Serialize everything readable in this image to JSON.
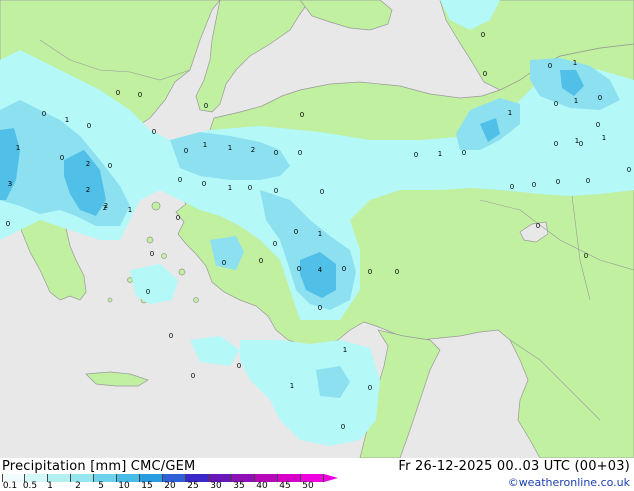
{
  "map": {
    "colors": {
      "sea": "#e8e8e8",
      "land": "#c0f0a0",
      "border": "#999999",
      "precip_light": "#b4f8f8",
      "precip_medium": "#8ce0f0",
      "precip_heavy": "#50c0e8"
    },
    "point_values": [
      "0",
      "1",
      "0",
      "0",
      "1",
      "0",
      "0",
      "2",
      "0",
      "0",
      "1",
      "2",
      "2",
      "0",
      "3",
      "0",
      "0",
      "0",
      "1",
      "0",
      "1",
      "1",
      "2",
      "0",
      "0",
      "0",
      "0",
      "0",
      "0",
      "0",
      "1",
      "1",
      "0",
      "0",
      "0",
      "0",
      "0",
      "4",
      "0",
      "0",
      "0",
      "0",
      "0",
      "0",
      "0",
      "1",
      "2",
      "0",
      "0",
      "0",
      "0",
      "1",
      "0",
      "0",
      "0",
      "0",
      "1",
      "0",
      "0",
      "1",
      "0",
      "0",
      "0",
      "0",
      "1",
      "0",
      "0",
      "1",
      "0",
      "0",
      "0",
      "0",
      "0",
      "1"
    ]
  },
  "footer": {
    "title": "Precipitation [mm]  CMC/GEM",
    "datetime": "Fr 26-12-2025 00..03 UTC (00+03)",
    "credit": "©weatheronline.co.uk",
    "scale_labels": [
      "0.1",
      "0.5",
      "1",
      "2",
      "5",
      "10",
      "15",
      "20",
      "25",
      "30",
      "35",
      "40",
      "45",
      "50"
    ],
    "scale_colors": [
      "#f0fcfc",
      "#d2f8f8",
      "#b4f0f0",
      "#96e6f0",
      "#6ed2ec",
      "#46bce6",
      "#2a9ce0",
      "#2f60d8",
      "#3c28c8",
      "#6818b8",
      "#9010b8",
      "#b808b8",
      "#d800c8",
      "#f000e0"
    ]
  }
}
